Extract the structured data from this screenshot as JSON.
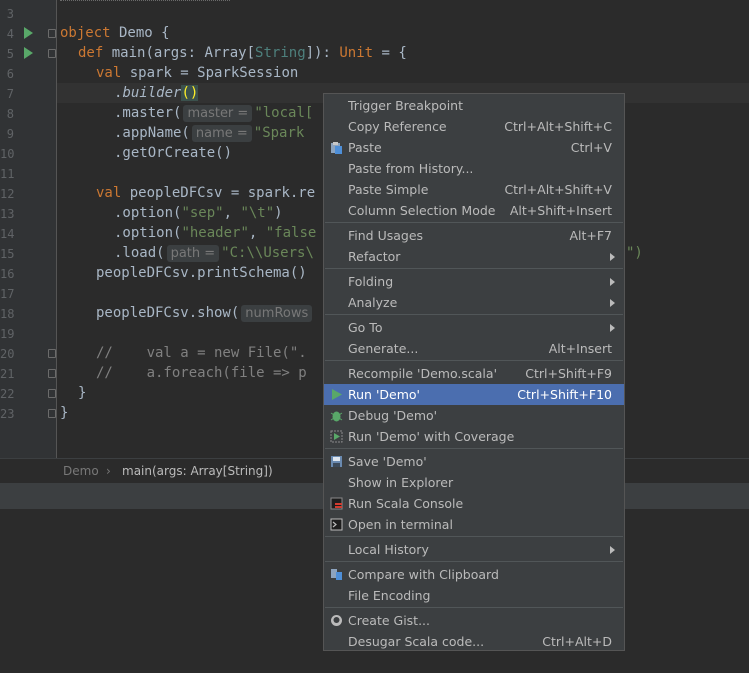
{
  "editor": {
    "line_numbers": [
      "3",
      "4",
      "5",
      "6",
      "7",
      "8",
      "9",
      "10",
      "11",
      "12",
      "13",
      "14",
      "15",
      "16",
      "17",
      "18",
      "19",
      "20",
      "21",
      "22",
      "23"
    ],
    "code": {
      "l4_kw": "object",
      "l4_rest": " Demo {",
      "l5_kw": "def",
      "l5_name": " main(args: ",
      "l5_type1": "Array",
      "l5_b1": "[",
      "l5_type2": "String",
      "l5_b2": "]): ",
      "l5_type3": "Unit",
      "l5_rest": " = {",
      "l6_kw": "val",
      "l6_rest": " spark = SparkSession",
      "l7_dot": ".",
      "l7_method": "builder",
      "l7_paren": "()",
      "l8_a": ".master(",
      "l8_hint": "master =",
      "l8_str": "\"local[",
      "l9_a": ".appName(",
      "l9_hint": "name =",
      "l9_str": "\"Spark",
      "l10": ".getOrCreate()",
      "l12_kw": "val",
      "l12_rest": " peopleDFCsv = spark.re",
      "l13_a": ".option(",
      "l13_s1": "\"sep\"",
      "l13_c": ", ",
      "l13_s2": "\"\\t\"",
      "l13_e": ")",
      "l14_a": ".option(",
      "l14_s1": "\"header\"",
      "l14_c": ", ",
      "l14_s2": "\"false",
      "l15_a": ".load(",
      "l15_hint": "path =",
      "l15_str": "\"C:\\\\Users\\",
      "l15_tail": "\")",
      "l16": "peopleDFCsv.printSchema()",
      "l18_a": "peopleDFCsv.show(",
      "l18_hint": "numRows",
      "l20": "//    val a = new File(\".",
      "l21": "//    a.foreach(file => p",
      "l22": "}",
      "l23": "}"
    }
  },
  "breadcrumb": {
    "object": "Demo",
    "separator": "›",
    "method": "main(args: Array[String])"
  },
  "context_menu": {
    "items": [
      {
        "label": "Trigger Breakpoint",
        "shortcut": ""
      },
      {
        "label": "Copy Reference",
        "shortcut": "Ctrl+Alt+Shift+C"
      },
      {
        "label": "Paste",
        "shortcut": "Ctrl+V",
        "icon": "clipboard-icon"
      },
      {
        "label": "Paste from History...",
        "shortcut": ""
      },
      {
        "label": "Paste Simple",
        "shortcut": "Ctrl+Alt+Shift+V"
      },
      {
        "label": "Column Selection Mode",
        "shortcut": "Alt+Shift+Insert"
      },
      {
        "label": "Find Usages",
        "shortcut": "Alt+F7"
      },
      {
        "label": "Refactor",
        "shortcut": ""
      },
      {
        "label": "Folding",
        "shortcut": ""
      },
      {
        "label": "Analyze",
        "shortcut": ""
      },
      {
        "label": "Go To",
        "shortcut": ""
      },
      {
        "label": "Generate...",
        "shortcut": "Alt+Insert"
      },
      {
        "label": "Recompile 'Demo.scala'",
        "shortcut": "Ctrl+Shift+F9"
      },
      {
        "label": "Run 'Demo'",
        "shortcut": "Ctrl+Shift+F10",
        "icon": "run-icon"
      },
      {
        "label": "Debug 'Demo'",
        "shortcut": "",
        "icon": "debug-icon"
      },
      {
        "label": "Run 'Demo' with Coverage",
        "shortcut": "",
        "icon": "coverage-icon"
      },
      {
        "label": "Save 'Demo'",
        "shortcut": "",
        "icon": "save-icon"
      },
      {
        "label": "Show in Explorer",
        "shortcut": ""
      },
      {
        "label": "Run Scala Console",
        "shortcut": "",
        "icon": "scala-console-icon"
      },
      {
        "label": "Open in terminal",
        "shortcut": "",
        "icon": "terminal-icon"
      },
      {
        "label": "Local History",
        "shortcut": ""
      },
      {
        "label": "Compare with Clipboard",
        "shortcut": "",
        "icon": "compare-icon"
      },
      {
        "label": "File Encoding",
        "shortcut": ""
      },
      {
        "label": "Create Gist...",
        "shortcut": "",
        "icon": "github-icon"
      },
      {
        "label": "Desugar Scala code...",
        "shortcut": "Ctrl+Alt+D"
      }
    ],
    "selected": "Run 'Demo'"
  },
  "colors": {
    "selection": "#4b6eaf",
    "menu_bg": "#3c3f41",
    "editor_bg": "#2b2b2b",
    "keyword": "#cc7832",
    "string": "#6a8759"
  }
}
